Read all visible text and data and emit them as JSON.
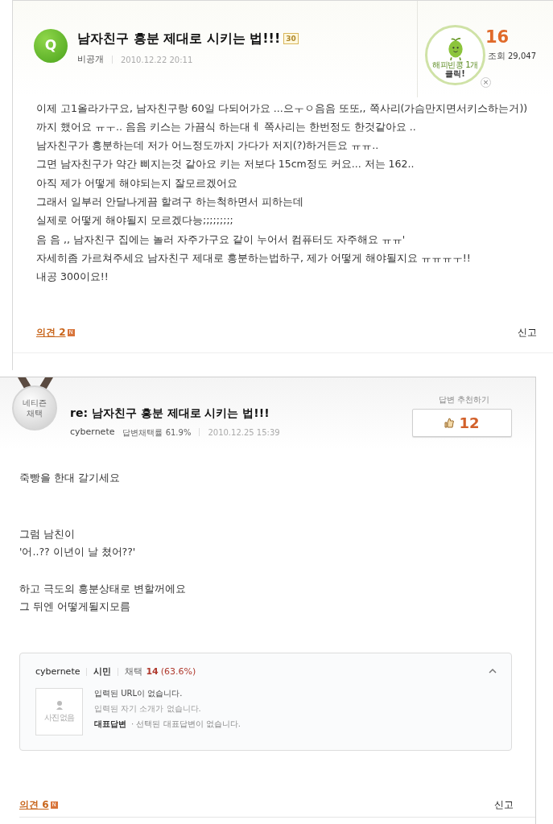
{
  "question": {
    "badge": "Q",
    "title": "남자친구 흥분 제대로 시키는 법!!!",
    "points": "30",
    "author": "비공개",
    "date": "2010.12.22 20:11",
    "happybean": {
      "line1": "해피빈콩 1개",
      "line2": "클릭!",
      "close": "×"
    },
    "count": "16",
    "views_label": "조회",
    "views": "29,047",
    "body": [
      "이제 고1올라가구요, 남자친구랑 60일 다되어가요 ...으ㅜㅇ음음 또또,, 쪽사리(가슴만지면서키스하는거))까지 했어요 ㅠㅜ.. 음음 키스는 가끔식 하는대ㅔ 쪽사리는 한번정도 한것같아요 ..",
      "남자친구가 흥분하는데 저가 어느정도까지 가다가 저지(?)하거든요 ㅠㅠ..",
      "그면 남자친구가 약간 삐지는것 같아요 키는 저보다 15cm정도 커요... 저는 162..",
      "아직 제가 어떻게 해야되는지 잘모르겠어요",
      "그래서 일부러 안달나게끔 할려구 하는척하면서 피하는데",
      "실제로 어떻게 해야될지 모르겠다능;;;;;;;;;",
      "음 음 ,, 남자친구 집에는 놀러 자주가구요 같이 누어서 컴퓨터도 자주해요 ㅠㅠ'",
      "자세히좀 가르쳐주세요 남자친구 제대로 흥분하는법하구, 제가 어떻게 해야될지요 ㅠㅠㅠㅜ!!",
      "내공 300이요!!"
    ],
    "comments": "의견 2",
    "new": "N",
    "report": "신고"
  },
  "answer": {
    "medal": [
      "네티즌",
      "채택"
    ],
    "title": "re: 남자친구 흥분 제대로 시키는 법!!!",
    "author": "cybernete",
    "rate": "답변채택률 61.9%",
    "date": "2010.12.25 15:39",
    "recommend_label": "답변 추천하기",
    "recommend_count": "12",
    "paragraphs": [
      [
        "죽빵을 한대 갈기세요"
      ],
      [
        "그럼 남친이",
        "'어..?? 이년이 날 쳤어??'"
      ],
      [
        "하고 극도의 흥분상태로 변할꺼에요",
        "그 뒤엔 어떻게될지모름"
      ]
    ],
    "profile": {
      "name": "cybernete",
      "grade": "시민",
      "adopt_label": "채택",
      "adopt_count": "14",
      "adopt_rate": "(63.6%)",
      "no_photo": "사진없음",
      "url": "입력된 URL이 없습니다.",
      "intro": "입력된 자기 소개가 없습니다.",
      "rep_label": "대표답변",
      "rep_value": "· 선택된 대표답변이 없습니다."
    },
    "comments": "의견 6",
    "new": "N",
    "report": "신고"
  }
}
